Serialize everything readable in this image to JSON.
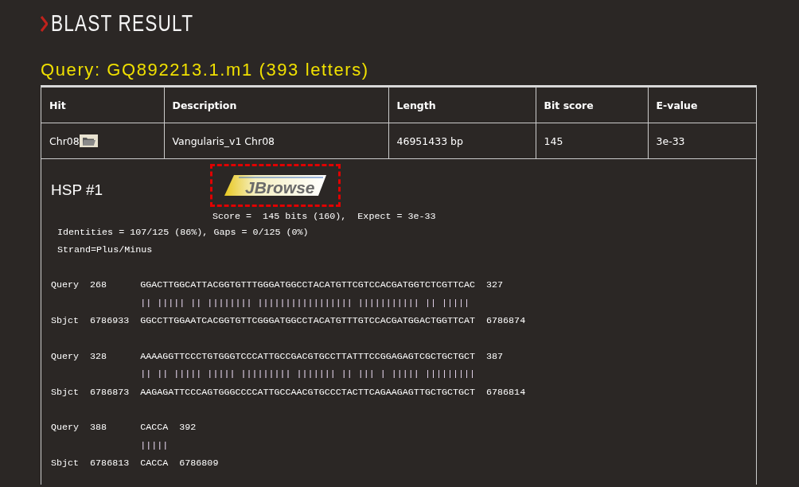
{
  "page_title": "BLAST RESULT",
  "query_heading": "Query: GQ892213.1.m1 (393 letters)",
  "table": {
    "columns": [
      "Hit",
      "Description",
      "Length",
      "Bit score",
      "E-value"
    ],
    "rows": [
      {
        "hit": "Chr08",
        "description": "Vangularis_v1 Chr08",
        "length": "46951433 bp",
        "bit_score": "145",
        "e_value": "3e-33"
      }
    ]
  },
  "hsp": {
    "title": "HSP #1",
    "jbrowse_label": "JBrowse",
    "score_line": "Score =  145 bits (160),  Expect = 3e-33",
    "identities_line": "Identities = 107/125 (86%), Gaps = 0/125 (0%)",
    "strand_line": "Strand=Plus/Minus",
    "blocks": [
      {
        "query": {
          "label": "Query",
          "start": "268",
          "seq": "GGACTTGGCATTACGGTGTTTGGGATGGCCTACATGTTCGTCCACGATGGTCTCGTTCAC",
          "end": "327"
        },
        "match": "|| ||||| || |||||||| ||||||||||||||||| ||||||||||| || |||||",
        "sbjct": {
          "label": "Sbjct",
          "start": "6786933",
          "seq": "GGCCTTGGAATCACGGTGTTCGGGATGGCCTACATGTTTGTCCACGATGGACTGGTTCAT",
          "end": "6786874"
        }
      },
      {
        "query": {
          "label": "Query",
          "start": "328",
          "seq": "AAAAGGTTCCCTGTGGGTCCCATTGCCGACGTGCCTTATTTCCGGAGAGTCGCTGCTGCT",
          "end": "387"
        },
        "match": "|| || ||||| ||||| ||||||||| ||||||| || ||| | ||||| |||||||||",
        "sbjct": {
          "label": "Sbjct",
          "start": "6786873",
          "seq": "AAGAGATTCCCAGTGGGCCCCATTGCCAACGTGCCCTACTTCAGAAGAGTTGCTGCTGCT",
          "end": "6786814"
        }
      },
      {
        "query": {
          "label": "Query",
          "start": "388",
          "seq": "CACCA",
          "end": "392"
        },
        "match": "|||||",
        "sbjct": {
          "label": "Sbjct",
          "start": "6786813",
          "seq": "CACCA",
          "end": "6786809"
        }
      }
    ]
  }
}
